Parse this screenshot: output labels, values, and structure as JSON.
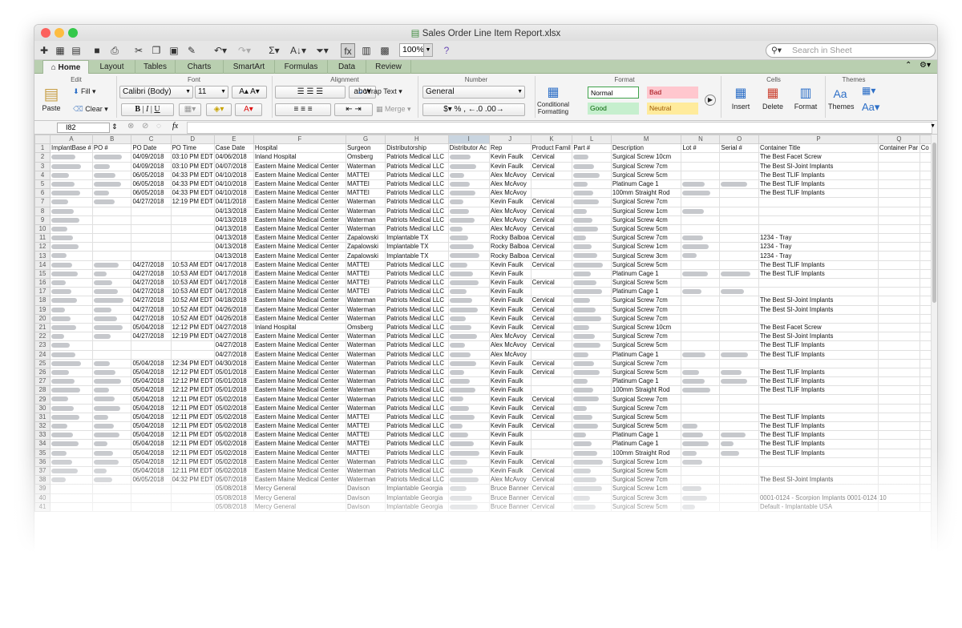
{
  "window": {
    "title": "Sales Order Line Item Report.xlsx"
  },
  "toolbar": {
    "zoom": "100%",
    "search_placeholder": "Search in Sheet"
  },
  "tabs": [
    "Home",
    "Layout",
    "Tables",
    "Charts",
    "SmartArt",
    "Formulas",
    "Data",
    "Review"
  ],
  "ribbon": {
    "groups": [
      "Edit",
      "Font",
      "Alignment",
      "Number",
      "Format",
      "Cells",
      "Themes"
    ],
    "fill": "Fill",
    "clear": "Clear",
    "paste": "Paste",
    "font_name": "Calibri (Body)",
    "font_size": "11",
    "wrap_text": "Wrap Text",
    "merge": "Merge",
    "abc": "abc",
    "number_format": "General",
    "conditional_formatting": "Conditional Formatting",
    "styles": {
      "normal": "Normal",
      "bad": "Bad",
      "good": "Good",
      "neutral": "Neutral"
    },
    "insert": "Insert",
    "delete": "Delete",
    "format": "Format",
    "themes": "Themes",
    "colors": {
      "tab_bar": "#b9cfb0",
      "bad_bg": "#ffc7ce",
      "bad_fg": "#9c0006",
      "good_bg": "#c6efce",
      "good_fg": "#006100",
      "neutral_bg": "#ffeb9c",
      "neutral_fg": "#9c5700"
    }
  },
  "formula": {
    "name_box": "I82",
    "fx": "fx"
  },
  "sheet": {
    "col_letters": [
      "A",
      "B",
      "C",
      "D",
      "E",
      "F",
      "G",
      "H",
      "I",
      "J",
      "K",
      "L",
      "M",
      "N",
      "O",
      "P",
      "Q",
      ""
    ],
    "headers": [
      "ImplantBase #",
      "PO #",
      "PO Date",
      "PO Time",
      "Case Date",
      "Hospital",
      "Surgeon",
      "Distributorship",
      "Distributor Ac",
      "Rep",
      "Product Famil",
      "Part #",
      "Description",
      "Lot #",
      "Serial #",
      "Container Title",
      "Container Par",
      "Co"
    ],
    "rows": [
      [
        "#",
        "#",
        "04/09/2018",
        "03:10 PM EDT",
        "04/06/2018",
        "Inland Hospital",
        "Omsberg",
        "Patriots Medical LLC",
        "#",
        "Kevin Faulk",
        "Cervical",
        "#",
        "Surgical Screw 10cm",
        "",
        "",
        "The Best Facet Screw",
        "",
        ""
      ],
      [
        "#",
        "#",
        "04/09/2018",
        "03:10 PM EDT",
        "04/07/2018",
        "Eastern Maine Medical Center",
        "Waterman",
        "Patriots Medical LLC",
        "#",
        "Kevin Faulk",
        "Cervical",
        "#",
        "Surgical Screw 7cm",
        "",
        "",
        "The Best SI-Joint Implants",
        "",
        ""
      ],
      [
        "#",
        "#",
        "06/05/2018",
        "04:33 PM EDT",
        "04/10/2018",
        "Eastern Maine Medical Center",
        "MATTEI",
        "Patriots Medical LLC",
        "#",
        "Alex McAvoy",
        "Cervical",
        "#",
        "Surgical Screw 5cm",
        "",
        "",
        "The Best TLIF Implants",
        "",
        ""
      ],
      [
        "#",
        "#",
        "06/05/2018",
        "04:33 PM EDT",
        "04/10/2018",
        "Eastern Maine Medical Center",
        "MATTEI",
        "Patriots Medical LLC",
        "#",
        "Alex McAvoy",
        "",
        "#",
        "Platinum Cage 1",
        "#",
        "#",
        "The Best TLIF Implants",
        "",
        ""
      ],
      [
        "#",
        "#",
        "06/05/2018",
        "04:33 PM EDT",
        "04/10/2018",
        "Eastern Maine Medical Center",
        "MATTEI",
        "Patriots Medical LLC",
        "#",
        "Alex McAvoy",
        "",
        "#",
        "100mm Straight Rod",
        "#",
        "",
        "The Best TLIF Implants",
        "",
        ""
      ],
      [
        "#",
        "#",
        "04/27/2018",
        "12:19 PM EDT",
        "04/11/2018",
        "Eastern Maine Medical Center",
        "Waterman",
        "Patriots Medical LLC",
        "#",
        "Kevin Faulk",
        "Cervical",
        "#",
        "Surgical Screw 7cm",
        "",
        "",
        "",
        "",
        ""
      ],
      [
        "#",
        "",
        "",
        "",
        "04/13/2018",
        "Eastern Maine Medical Center",
        "Waterman",
        "Patriots Medical LLC",
        "#",
        "Alex McAvoy",
        "Cervical",
        "#",
        "Surgical Screw 1cm",
        "#",
        "",
        "",
        "",
        ""
      ],
      [
        "#",
        "",
        "",
        "",
        "04/13/2018",
        "Eastern Maine Medical Center",
        "Waterman",
        "Patriots Medical LLC",
        "#",
        "Alex McAvoy",
        "Cervical",
        "#",
        "Surgical Screw 4cm",
        "",
        "",
        "",
        "",
        ""
      ],
      [
        "#",
        "",
        "",
        "",
        "04/13/2018",
        "Eastern Maine Medical Center",
        "Waterman",
        "Patriots Medical LLC",
        "#",
        "Alex McAvoy",
        "Cervical",
        "#",
        "Surgical Screw 5cm",
        "",
        "",
        "",
        "",
        ""
      ],
      [
        "#",
        "",
        "",
        "",
        "04/13/2018",
        "Eastern Maine Medical Center",
        "Zapalowski",
        "Implantable TX",
        "#",
        "Rocky Balboa",
        "Cervical",
        "#",
        "Surgical Screw 7cm",
        "#",
        "",
        "1234 - Tray",
        "",
        ""
      ],
      [
        "#",
        "",
        "",
        "",
        "04/13/2018",
        "Eastern Maine Medical Center",
        "Zapalowski",
        "Implantable TX",
        "#",
        "Rocky Balboa",
        "Cervical",
        "#",
        "Surgical Screw 1cm",
        "#",
        "",
        "1234 - Tray",
        "",
        ""
      ],
      [
        "#",
        "",
        "",
        "",
        "04/13/2018",
        "Eastern Maine Medical Center",
        "Zapalowski",
        "Implantable TX",
        "#",
        "Rocky Balboa",
        "Cervical",
        "#",
        "Surgical Screw 3cm",
        "#",
        "",
        "1234 - Tray",
        "",
        ""
      ],
      [
        "#",
        "#",
        "04/27/2018",
        "10:53 AM EDT",
        "04/17/2018",
        "Eastern Maine Medical Center",
        "MATTEI",
        "Patriots Medical LLC",
        "#",
        "Kevin Faulk",
        "Cervical",
        "#",
        "Surgical Screw 5cm",
        "",
        "",
        "The Best TLIF Implants",
        "",
        ""
      ],
      [
        "#",
        "#",
        "04/27/2018",
        "10:53 AM EDT",
        "04/17/2018",
        "Eastern Maine Medical Center",
        "MATTEI",
        "Patriots Medical LLC",
        "#",
        "Kevin Faulk",
        "",
        "#",
        "Platinum Cage 1",
        "#",
        "#",
        "The Best TLIF Implants",
        "",
        ""
      ],
      [
        "#",
        "#",
        "04/27/2018",
        "10:53 AM EDT",
        "04/17/2018",
        "Eastern Maine Medical Center",
        "MATTEI",
        "Patriots Medical LLC",
        "#",
        "Kevin Faulk",
        "Cervical",
        "#",
        "Surgical Screw 5cm",
        "",
        "",
        "",
        "",
        ""
      ],
      [
        "#",
        "#",
        "04/27/2018",
        "10:53 AM EDT",
        "04/17/2018",
        "Eastern Maine Medical Center",
        "MATTEI",
        "Patriots Medical LLC",
        "#",
        "Kevin Faulk",
        "",
        "#",
        "Platinum Cage 1",
        "#",
        "#",
        "",
        "",
        ""
      ],
      [
        "#",
        "#",
        "04/27/2018",
        "10:52 AM EDT",
        "04/18/2018",
        "Eastern Maine Medical Center",
        "Waterman",
        "Patriots Medical LLC",
        "#",
        "Kevin Faulk",
        "Cervical",
        "#",
        "Surgical Screw 7cm",
        "",
        "",
        "The Best SI-Joint Implants",
        "",
        ""
      ],
      [
        "#",
        "#",
        "04/27/2018",
        "10:52 AM EDT",
        "04/26/2018",
        "Eastern Maine Medical Center",
        "Waterman",
        "Patriots Medical LLC",
        "#",
        "Kevin Faulk",
        "Cervical",
        "#",
        "Surgical Screw 7cm",
        "",
        "",
        "The Best SI-Joint Implants",
        "",
        ""
      ],
      [
        "#",
        "#",
        "04/27/2018",
        "10:52 AM EDT",
        "04/26/2018",
        "Eastern Maine Medical Center",
        "Waterman",
        "Patriots Medical LLC",
        "#",
        "Kevin Faulk",
        "Cervical",
        "#",
        "Surgical Screw 7cm",
        "",
        "",
        "",
        "",
        ""
      ],
      [
        "#",
        "#",
        "05/04/2018",
        "12:12 PM EDT",
        "04/27/2018",
        "Inland Hospital",
        "Omsberg",
        "Patriots Medical LLC",
        "#",
        "Kevin Faulk",
        "Cervical",
        "#",
        "Surgical Screw 10cm",
        "",
        "",
        "The Best Facet Screw",
        "",
        ""
      ],
      [
        "#",
        "#",
        "04/27/2018",
        "12:19 PM EDT",
        "04/27/2018",
        "Eastern Maine Medical Center",
        "Waterman",
        "Patriots Medical LLC",
        "#",
        "Alex McAvoy",
        "Cervical",
        "#",
        "Surgical Screw 7cm",
        "",
        "",
        "The Best SI-Joint Implants",
        "",
        ""
      ],
      [
        "#",
        "",
        "",
        "",
        "04/27/2018",
        "Eastern Maine Medical Center",
        "Waterman",
        "Patriots Medical LLC",
        "#",
        "Alex McAvoy",
        "Cervical",
        "#",
        "Surgical Screw 5cm",
        "",
        "",
        "The Best TLIF Implants",
        "",
        ""
      ],
      [
        "#",
        "",
        "",
        "",
        "04/27/2018",
        "Eastern Maine Medical Center",
        "Waterman",
        "Patriots Medical LLC",
        "#",
        "Alex McAvoy",
        "",
        "#",
        "Platinum Cage 1",
        "#",
        "#",
        "The Best TLIF Implants",
        "",
        ""
      ],
      [
        "#",
        "#",
        "05/04/2018",
        "12:34 PM EDT",
        "04/30/2018",
        "Eastern Maine Medical Center",
        "Waterman",
        "Patriots Medical LLC",
        "#",
        "Kevin Faulk",
        "Cervical",
        "#",
        "Surgical Screw 7cm",
        "",
        "",
        "",
        "",
        ""
      ],
      [
        "#",
        "#",
        "05/04/2018",
        "12:12 PM EDT",
        "05/01/2018",
        "Eastern Maine Medical Center",
        "Waterman",
        "Patriots Medical LLC",
        "#",
        "Kevin Faulk",
        "Cervical",
        "#",
        "Surgical Screw 5cm",
        "#",
        "#",
        "The Best TLIF Implants",
        "",
        ""
      ],
      [
        "#",
        "#",
        "05/04/2018",
        "12:12 PM EDT",
        "05/01/2018",
        "Eastern Maine Medical Center",
        "Waterman",
        "Patriots Medical LLC",
        "#",
        "Kevin Faulk",
        "",
        "#",
        "Platinum Cage 1",
        "#",
        "#",
        "The Best TLIF Implants",
        "",
        ""
      ],
      [
        "#",
        "#",
        "05/04/2018",
        "12:12 PM EDT",
        "05/01/2018",
        "Eastern Maine Medical Center",
        "Waterman",
        "Patriots Medical LLC",
        "#",
        "Kevin Faulk",
        "",
        "#",
        "100mm Straight Rod",
        "#",
        "",
        "The Best TLIF Implants",
        "",
        ""
      ],
      [
        "#",
        "#",
        "05/04/2018",
        "12:11 PM EDT",
        "05/02/2018",
        "Eastern Maine Medical Center",
        "Waterman",
        "Patriots Medical LLC",
        "#",
        "Kevin Faulk",
        "Cervical",
        "#",
        "Surgical Screw 7cm",
        "",
        "",
        "",
        "",
        ""
      ],
      [
        "#",
        "#",
        "05/04/2018",
        "12:11 PM EDT",
        "05/02/2018",
        "Eastern Maine Medical Center",
        "Waterman",
        "Patriots Medical LLC",
        "#",
        "Kevin Faulk",
        "Cervical",
        "#",
        "Surgical Screw 7cm",
        "",
        "",
        "",
        "",
        ""
      ],
      [
        "#",
        "#",
        "05/04/2018",
        "12:11 PM EDT",
        "05/02/2018",
        "Eastern Maine Medical Center",
        "MATTEI",
        "Patriots Medical LLC",
        "#",
        "Kevin Faulk",
        "Cervical",
        "#",
        "Surgical Screw 5cm",
        "",
        "",
        "The Best TLIF Implants",
        "",
        ""
      ],
      [
        "#",
        "#",
        "05/04/2018",
        "12:11 PM EDT",
        "05/02/2018",
        "Eastern Maine Medical Center",
        "MATTEI",
        "Patriots Medical LLC",
        "#",
        "Kevin Faulk",
        "Cervical",
        "#",
        "Surgical Screw 5cm",
        "#",
        "",
        "The Best TLIF Implants",
        "",
        ""
      ],
      [
        "#",
        "#",
        "05/04/2018",
        "12:11 PM EDT",
        "05/02/2018",
        "Eastern Maine Medical Center",
        "MATTEI",
        "Patriots Medical LLC",
        "#",
        "Kevin Faulk",
        "",
        "#",
        "Platinum Cage 1",
        "#",
        "#",
        "The Best TLIF Implants",
        "",
        ""
      ],
      [
        "#",
        "#",
        "05/04/2018",
        "12:11 PM EDT",
        "05/02/2018",
        "Eastern Maine Medical Center",
        "MATTEI",
        "Patriots Medical LLC",
        "#",
        "Kevin Faulk",
        "",
        "#",
        "Platinum Cage 1",
        "#",
        "#",
        "The Best TLIF Implants",
        "",
        ""
      ],
      [
        "#",
        "#",
        "05/04/2018",
        "12:11 PM EDT",
        "05/02/2018",
        "Eastern Maine Medical Center",
        "MATTEI",
        "Patriots Medical LLC",
        "#",
        "Kevin Faulk",
        "",
        "#",
        "100mm Straight Rod",
        "#",
        "#",
        "The Best TLIF Implants",
        "",
        ""
      ],
      [
        "#",
        "#",
        "05/04/2018",
        "12:11 PM EDT",
        "05/02/2018",
        "Eastern Maine Medical Center",
        "Waterman",
        "Patriots Medical LLC",
        "#",
        "Kevin Faulk",
        "Cervical",
        "#",
        "Surgical Screw 1cm",
        "#",
        "",
        "",
        "",
        ""
      ],
      [
        "#",
        "#",
        "05/04/2018",
        "12:11 PM EDT",
        "05/02/2018",
        "Eastern Maine Medical Center",
        "Waterman",
        "Patriots Medical LLC",
        "#",
        "Kevin Faulk",
        "Cervical",
        "#",
        "Surgical Screw 5cm",
        "",
        "",
        "",
        "",
        ""
      ],
      [
        "#",
        "#",
        "06/05/2018",
        "04:32 PM EDT",
        "05/07/2018",
        "Eastern Maine Medical Center",
        "Waterman",
        "Patriots Medical LLC",
        "#",
        "Alex McAvoy",
        "Cervical",
        "#",
        "Surgical Screw 7cm",
        "",
        "",
        "The Best SI-Joint Implants",
        "",
        ""
      ],
      [
        "",
        "",
        "",
        "",
        "05/08/2018",
        "Mercy General",
        "Davison",
        "Implantable Georgia",
        "#",
        "Bruce Banner",
        "Cervical",
        "#",
        "Surgical Screw 1cm",
        "#",
        "",
        "",
        "",
        ""
      ],
      [
        "",
        "",
        "",
        "",
        "05/08/2018",
        "Mercy General",
        "Davison",
        "Implantable Georgia",
        "#",
        "Bruce Banner",
        "Cervical",
        "#",
        "Surgical Screw 3cm",
        "#",
        "",
        "0001-0124 - Scorpion Implants 0001-0124",
        "10",
        ""
      ],
      [
        "",
        "",
        "",
        "",
        "05/08/2018",
        "Mercy General",
        "Davison",
        "Implantable Georgia",
        "#",
        "Bruce Banner",
        "Cervical",
        "#",
        "Surgical Screw 5cm",
        "#",
        "",
        "Default - Implantable USA",
        "",
        ""
      ]
    ]
  }
}
